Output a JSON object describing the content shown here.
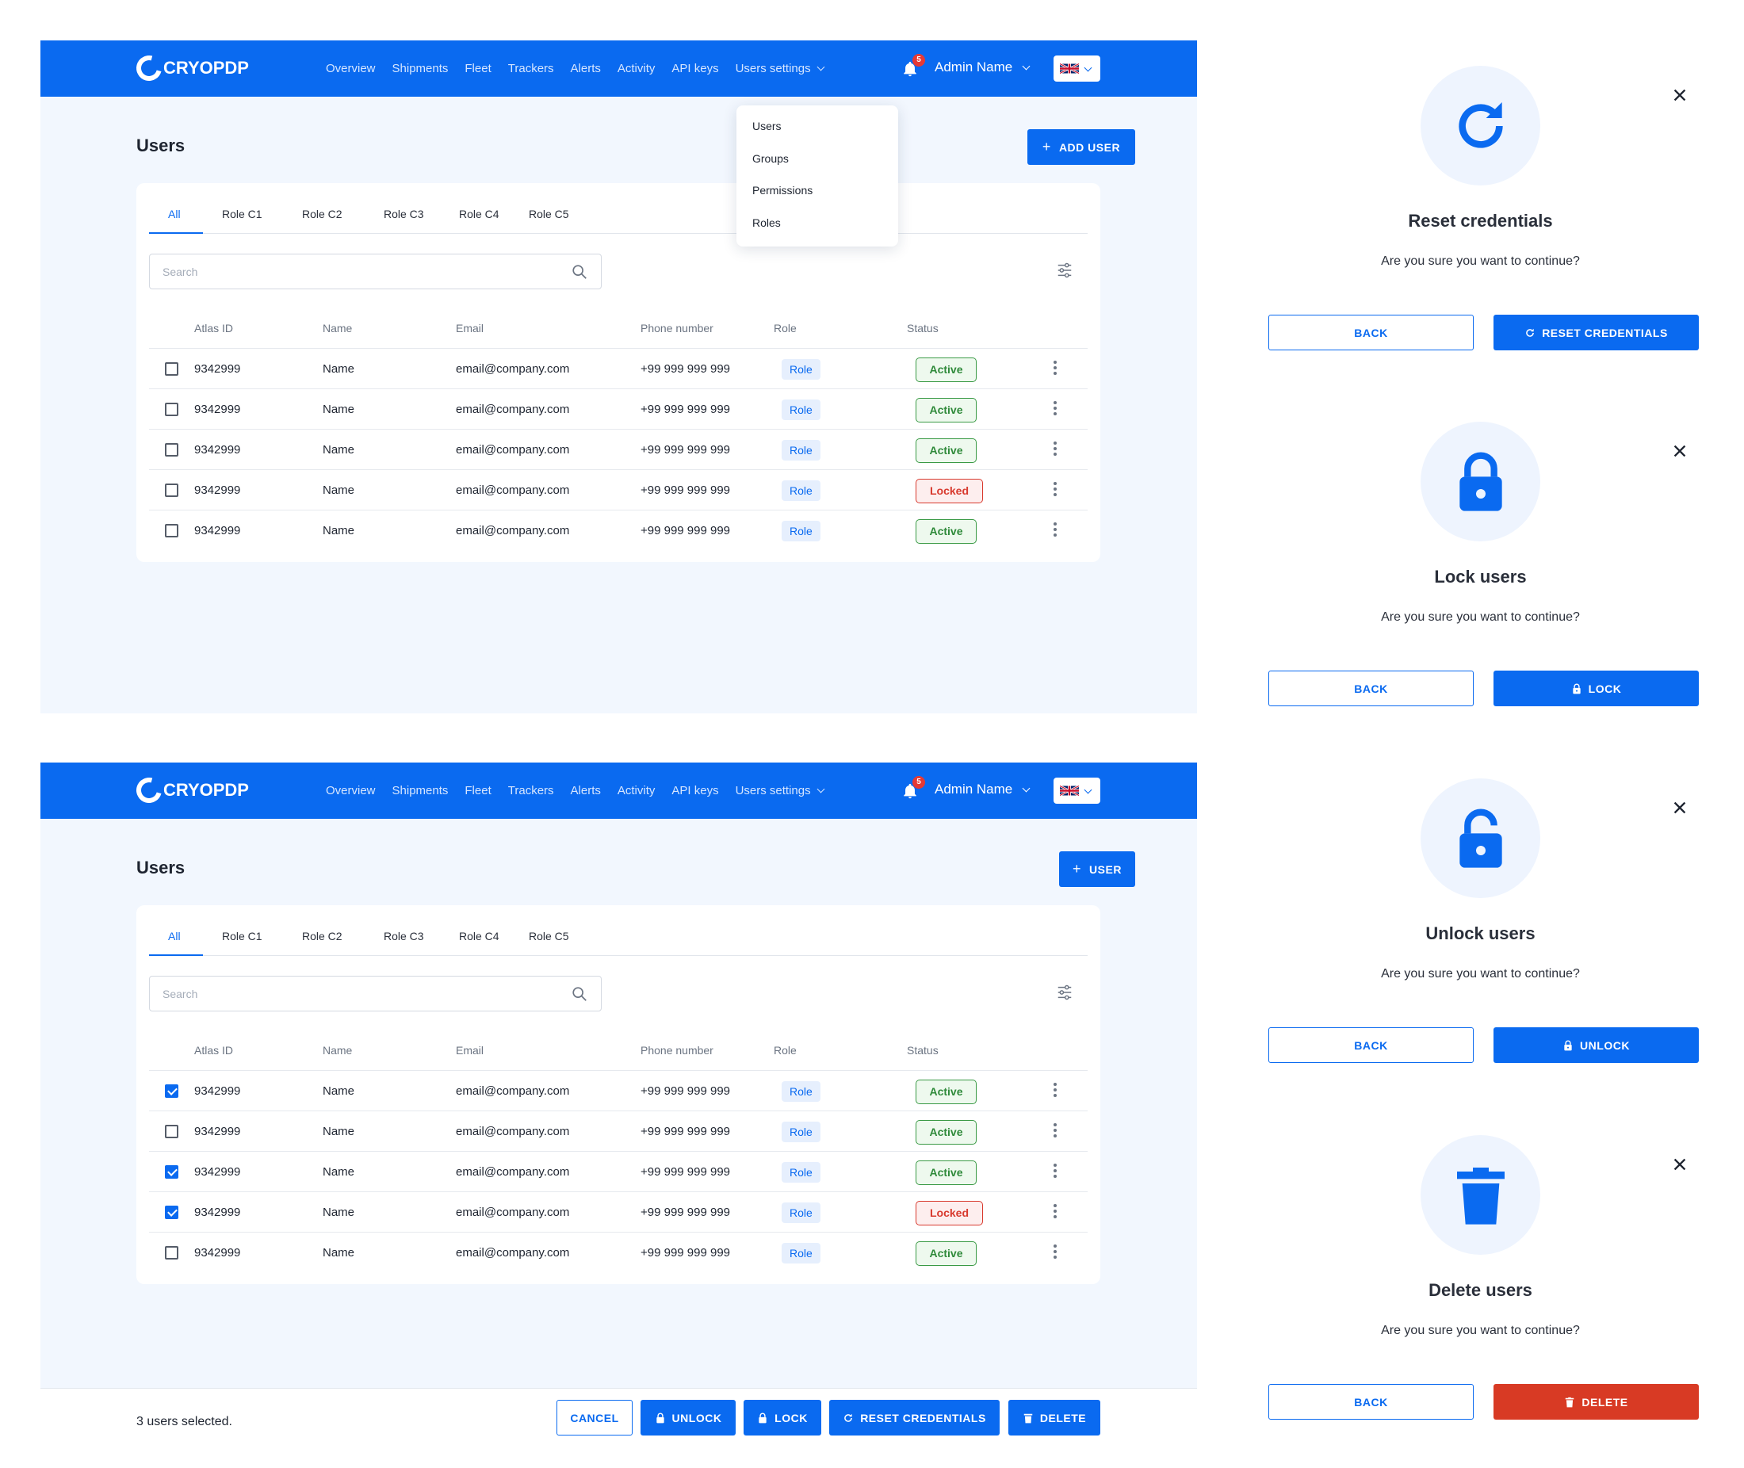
{
  "brand": {
    "name": "CRYOPDP",
    "primary_color": "#0a6af0",
    "danger_color": "#d83a24"
  },
  "nav": {
    "items": [
      "Overview",
      "Shipments",
      "Fleet",
      "Trackers",
      "Alerts",
      "Activity",
      "API keys"
    ],
    "settings_label": "Users settings",
    "notification_count": "5",
    "admin_name": "Admin Name",
    "language_flag": "uk-flag-icon"
  },
  "screen1": {
    "title": "Users",
    "add_button_label": "ADD USER",
    "dropdown": [
      "Users",
      "Groups",
      "Permissions",
      "Roles"
    ]
  },
  "screen2": {
    "title": "Users",
    "add_button_label": "USER",
    "selected_text": "3 users selected.",
    "actions": {
      "cancel": "CANCEL",
      "unlock": "UNLOCK",
      "lock": "LOCK",
      "reset": "RESET CREDENTIALS",
      "delete": "DELETE"
    }
  },
  "tabs": [
    "All",
    "Role C1",
    "Role C2",
    "Role C3",
    "Role C4",
    "Role C5"
  ],
  "search": {
    "placeholder": "Search"
  },
  "table": {
    "headers": [
      "Atlas ID",
      "Name",
      "Email",
      "Phone number",
      "Role",
      "Status"
    ],
    "rows": [
      {
        "id": "9342999",
        "name": "Name",
        "email": "email@company.com",
        "phone": "+99 999 999 999",
        "role": "Role",
        "status": "Active"
      },
      {
        "id": "9342999",
        "name": "Name",
        "email": "email@company.com",
        "phone": "+99 999 999 999",
        "role": "Role",
        "status": "Active"
      },
      {
        "id": "9342999",
        "name": "Name",
        "email": "email@company.com",
        "phone": "+99 999 999 999",
        "role": "Role",
        "status": "Active"
      },
      {
        "id": "9342999",
        "name": "Name",
        "email": "email@company.com",
        "phone": "+99 999 999 999",
        "role": "Role",
        "status": "Locked"
      },
      {
        "id": "9342999",
        "name": "Name",
        "email": "email@company.com",
        "phone": "+99 999 999 999",
        "role": "Role",
        "status": "Active"
      }
    ],
    "screen2_checked": [
      true,
      false,
      true,
      true,
      false
    ]
  },
  "modals": [
    {
      "icon": "refresh-icon",
      "title": "Reset credentials",
      "text": "Are you sure you want to continue?",
      "back": "BACK",
      "confirm": "RESET CREDENTIALS",
      "confirm_icon": "refresh-icon",
      "danger": false
    },
    {
      "icon": "lock-icon",
      "title": "Lock users",
      "text": "Are you sure you want to continue?",
      "back": "BACK",
      "confirm": "LOCK",
      "confirm_icon": "lock-icon",
      "danger": false
    },
    {
      "icon": "unlock-icon",
      "title": "Unlock users",
      "text": "Are you sure you want to continue?",
      "back": "BACK",
      "confirm": "UNLOCK",
      "confirm_icon": "lock-icon",
      "danger": false
    },
    {
      "icon": "trash-icon",
      "title": "Delete users",
      "text": "Are you sure you want to continue?",
      "back": "BACK",
      "confirm": "DELETE",
      "confirm_icon": "trash-icon",
      "danger": true
    }
  ]
}
